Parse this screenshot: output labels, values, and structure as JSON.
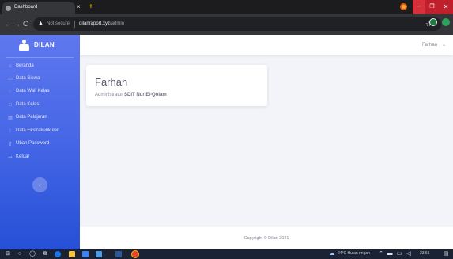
{
  "browser": {
    "tab_title": "Dashboard",
    "tab_close": "×",
    "new_tab": "+",
    "secure_label": "Not secure",
    "url_host": "dilanraport.xyz",
    "url_path": "/admin",
    "nav_back": "←",
    "nav_forward": "→",
    "nav_reload": "C",
    "star": "☆",
    "min": "–",
    "max": "❐",
    "close": "✕"
  },
  "sidebar": {
    "brand": "DILAN",
    "items": [
      {
        "label": "Beranda",
        "icon": "home-icon"
      },
      {
        "label": "Data Siswa",
        "icon": "users-icon"
      },
      {
        "label": "Data Wali Kelas",
        "icon": "teacher-icon"
      },
      {
        "label": "Data Kelas",
        "icon": "class-icon"
      },
      {
        "label": "Data Pelajaran",
        "icon": "book-icon"
      },
      {
        "label": "Data Ekstrakurikuler",
        "icon": "activity-icon"
      },
      {
        "label": "Ubah Password",
        "icon": "key-icon"
      },
      {
        "label": "Keluar",
        "icon": "logout-icon"
      }
    ],
    "collapse": "‹"
  },
  "topbar": {
    "user": "Farhan",
    "caret": "⌄"
  },
  "card": {
    "name": "Farhan",
    "role_prefix": "Administrator",
    "role_school": "SDIT Nur El-Qolam"
  },
  "footer": {
    "copyright": "Copyright © Dilan 2021"
  },
  "taskbar": {
    "weather": "24°C  Hujan ringan",
    "time": "23:51"
  },
  "colors": {
    "sidebar_top": "#5f78ef",
    "sidebar_bottom": "#2650d6",
    "background": "#f3f4f9",
    "close_button": "#c0202b"
  }
}
